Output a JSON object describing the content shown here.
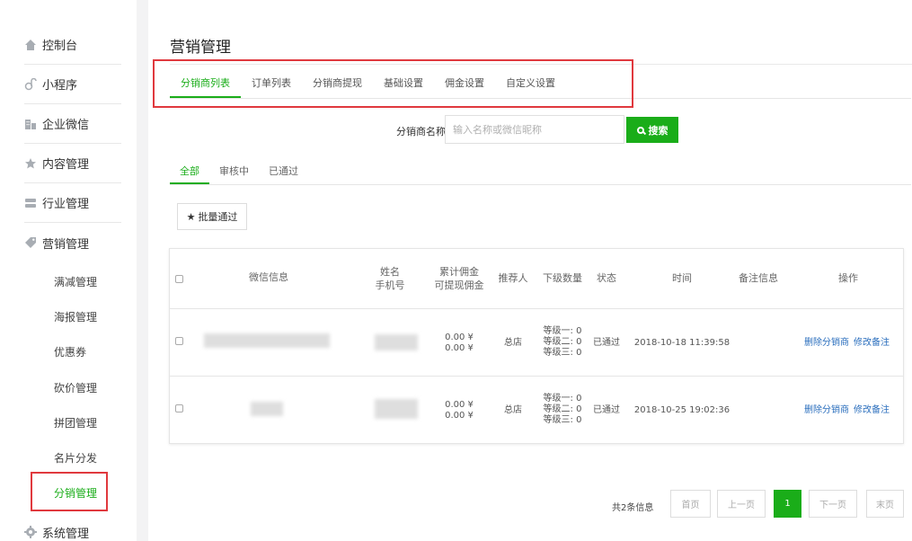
{
  "sidebar": {
    "items": [
      {
        "label": "控制台",
        "icon": "home-icon"
      },
      {
        "label": "小程序",
        "icon": "link-icon"
      },
      {
        "label": "企业微信",
        "icon": "building-icon"
      },
      {
        "label": "内容管理",
        "icon": "star-icon"
      },
      {
        "label": "行业管理",
        "icon": "layers-icon"
      },
      {
        "label": "营销管理",
        "icon": "tag-icon"
      }
    ],
    "sub_items": [
      "满减管理",
      "海报管理",
      "优惠券",
      "砍价管理",
      "拼团管理",
      "名片分发",
      "分销管理"
    ],
    "active_sub": "分销管理",
    "bottom_item": {
      "label": "系统管理",
      "icon": "gear-icon"
    }
  },
  "main": {
    "title": "营销管理",
    "tabs": [
      "分销商列表",
      "订单列表",
      "分销商提现",
      "基础设置",
      "佣金设置",
      "自定义设置"
    ],
    "active_tab": "分销商列表",
    "search": {
      "label": "分销商名称:",
      "placeholder": "输入名称或微信昵称",
      "button": "搜索"
    },
    "subtabs": [
      "全部",
      "审核中",
      "已通过"
    ],
    "active_subtab": "全部",
    "batch_button": "批量通过"
  },
  "table": {
    "headers": {
      "wechat": "微信信息",
      "name": "姓名",
      "phone": "手机号",
      "total_commission": "累计佣金",
      "withdrawable": "可提现佣金",
      "referrer": "推荐人",
      "sub_count": "下级数量",
      "status": "状态",
      "time": "时间",
      "remark": "备注信息",
      "actions": "操作"
    },
    "rows": [
      {
        "total": "0.00 ¥",
        "withdrawable": "0.00 ¥",
        "referrer": "总店",
        "level1": "等级一: 0",
        "level2": "等级二: 0",
        "level3": "等级三: 0",
        "status": "已通过",
        "time": "2018-10-18 11:39:58",
        "delete": "删除分销商",
        "edit": "修改备注"
      },
      {
        "total": "0.00 ¥",
        "withdrawable": "0.00 ¥",
        "referrer": "总店",
        "level1": "等级一: 0",
        "level2": "等级二: 0",
        "level3": "等级三: 0",
        "status": "已通过",
        "time": "2018-10-25 19:02:36",
        "delete": "删除分销商",
        "edit": "修改备注"
      }
    ]
  },
  "pagination": {
    "info": "共2条信息",
    "first": "首页",
    "prev": "上一页",
    "current": "1",
    "next": "下一页",
    "last": "末页"
  },
  "colors": {
    "accent": "#1aad19",
    "highlight": "#e0393e",
    "link": "#2a6ebd"
  }
}
